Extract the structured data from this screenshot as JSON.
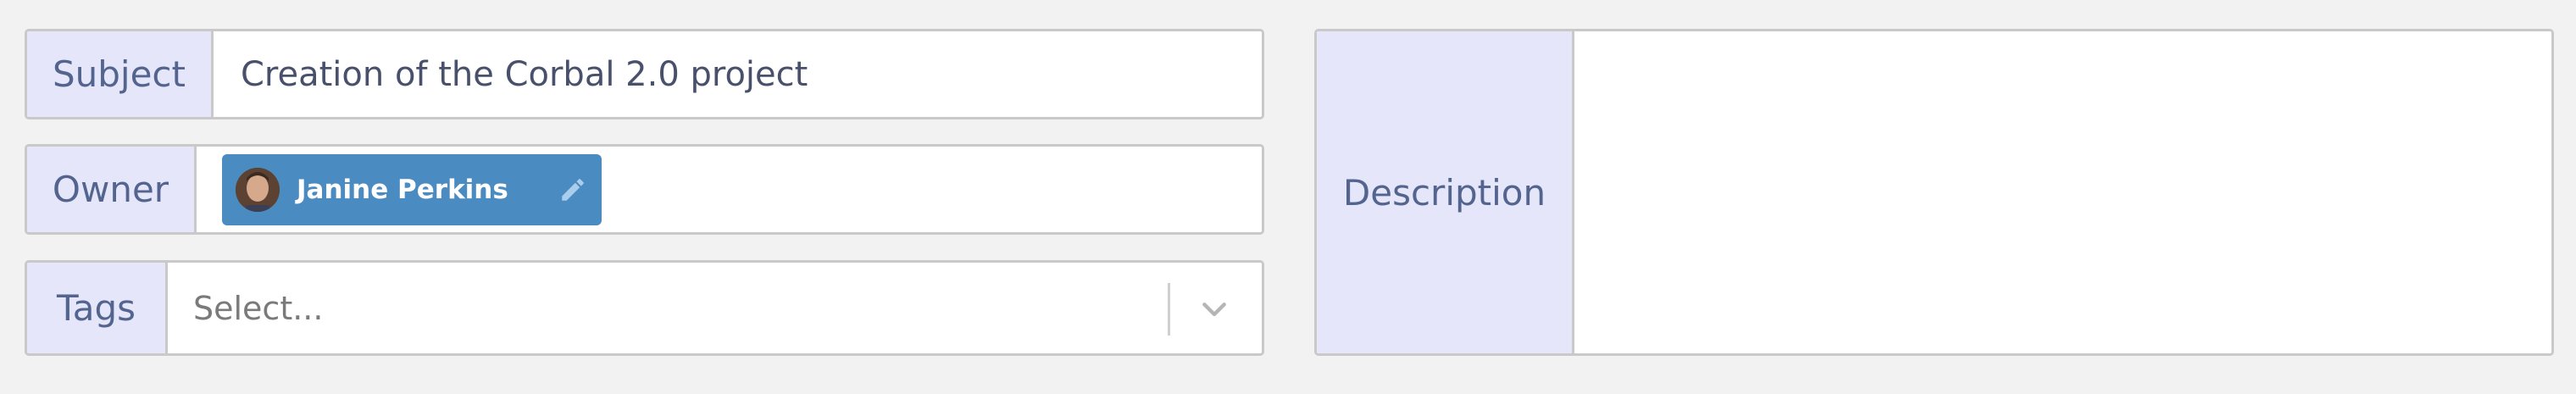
{
  "form": {
    "subject": {
      "label": "Subject",
      "value": "Creation of the Corbal 2.0 project"
    },
    "owner": {
      "label": "Owner",
      "name": "Janine Perkins",
      "avatar_icon": "user-avatar",
      "edit_icon": "pencil-icon",
      "chip_color": "#4a8bc2"
    },
    "tags": {
      "label": "Tags",
      "placeholder": "Select...",
      "dropdown_icon": "chevron-down-icon"
    },
    "description": {
      "label": "Description",
      "value": ""
    }
  },
  "colors": {
    "label_bg": "#e5e6fa",
    "label_text": "#53648f",
    "border": "#c9c9c9",
    "page_bg": "#f2f2f2"
  }
}
